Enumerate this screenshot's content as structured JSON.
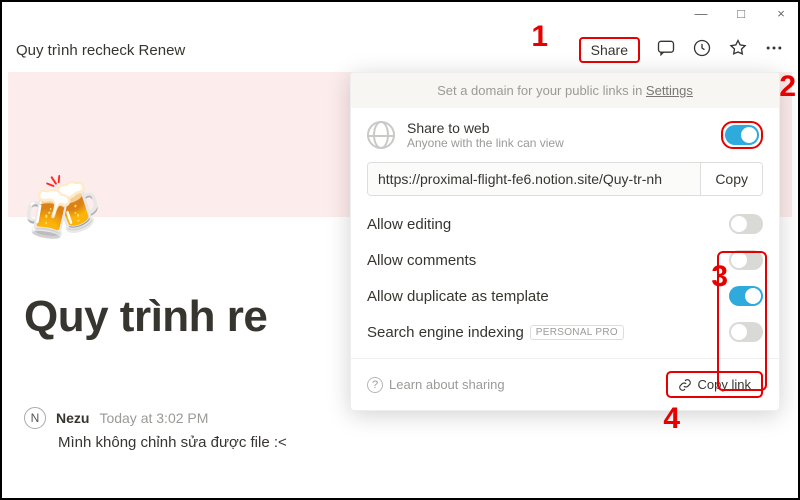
{
  "window": {
    "min": "—",
    "max": "□",
    "close": "×"
  },
  "breadcrumb": "Quy trình recheck Renew",
  "top": {
    "share": "Share"
  },
  "page": {
    "emoji": "🍻",
    "title": "Quy trình re",
    "author_initial": "N",
    "author_name": "Nezu",
    "author_time": "Today at 3:02 PM",
    "comment": "Mình không chỉnh sửa được file :<"
  },
  "share_popup": {
    "banner_prefix": "Set a domain for your public links in ",
    "banner_link": "Settings",
    "share_web_title": "Share to web",
    "share_web_sub": "Anyone with the link can view",
    "url": "https://proximal-flight-fe6.notion.site/Quy-tr-nh",
    "copy": "Copy",
    "opts": {
      "edit": "Allow editing",
      "comments": "Allow comments",
      "duplicate": "Allow duplicate as template",
      "search": "Search engine indexing",
      "pro_badge": "PERSONAL PRO"
    },
    "learn": "Learn about sharing",
    "copy_link": "Copy link"
  },
  "callouts": {
    "c1": "1",
    "c2": "2",
    "c3": "3",
    "c4": "4"
  }
}
